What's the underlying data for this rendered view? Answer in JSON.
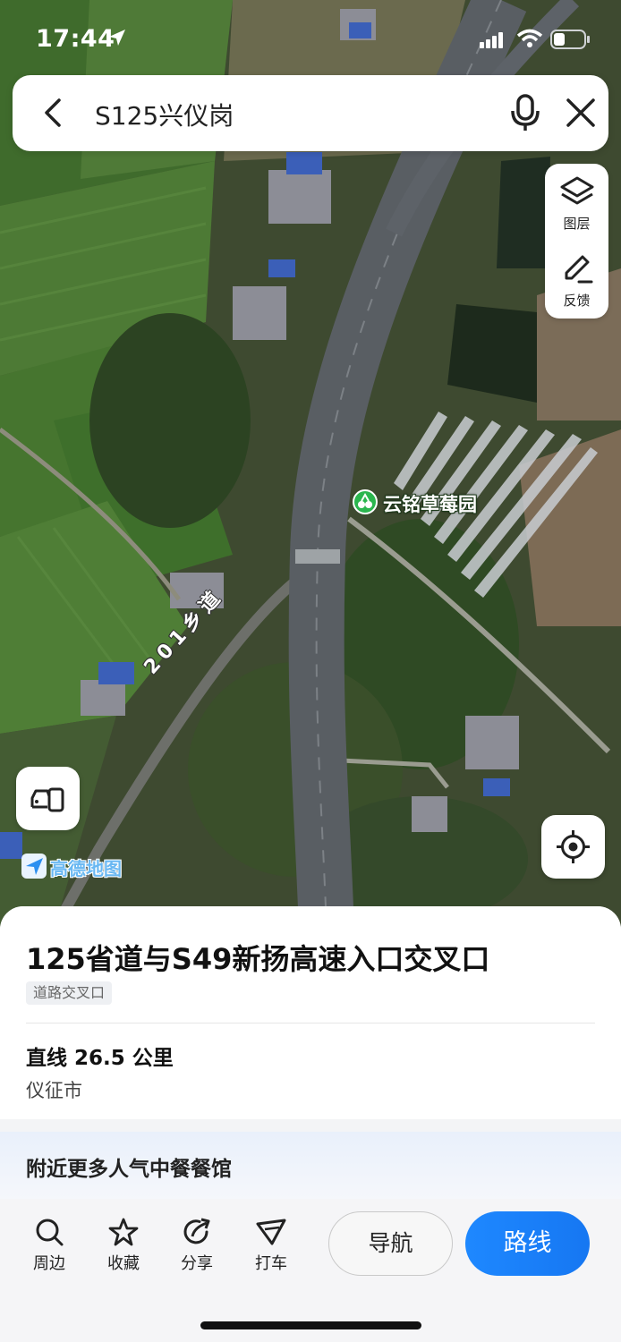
{
  "status_bar": {
    "time": "17:44",
    "icons": [
      "location-arrow-icon",
      "cellular-signal-icon",
      "wifi-icon",
      "battery-icon"
    ]
  },
  "search": {
    "query": "S125兴仪岗",
    "icons": [
      "back-icon",
      "microphone-icon",
      "close-icon"
    ]
  },
  "map_tools": {
    "layers_label": "图层",
    "feedback_label": "反馈"
  },
  "map": {
    "view": "satellite",
    "poi_label": "云铭草莓园",
    "road_label": "201乡道",
    "logo_text": "高德地图"
  },
  "place": {
    "title": "125省道与S49新扬高速入口交叉口",
    "type_tag": "道路交叉口",
    "distance": "直线 26.5 公里",
    "city": "仪征市"
  },
  "nearby": {
    "text": "附近更多人气中餐餐馆"
  },
  "actions": {
    "nearby": "周边",
    "favorite": "收藏",
    "share": "分享",
    "taxi": "打车"
  },
  "buttons": {
    "navigate": "导航",
    "route": "路线"
  },
  "colors": {
    "accent": "#1677f2",
    "poi_green": "#2bb64e"
  }
}
